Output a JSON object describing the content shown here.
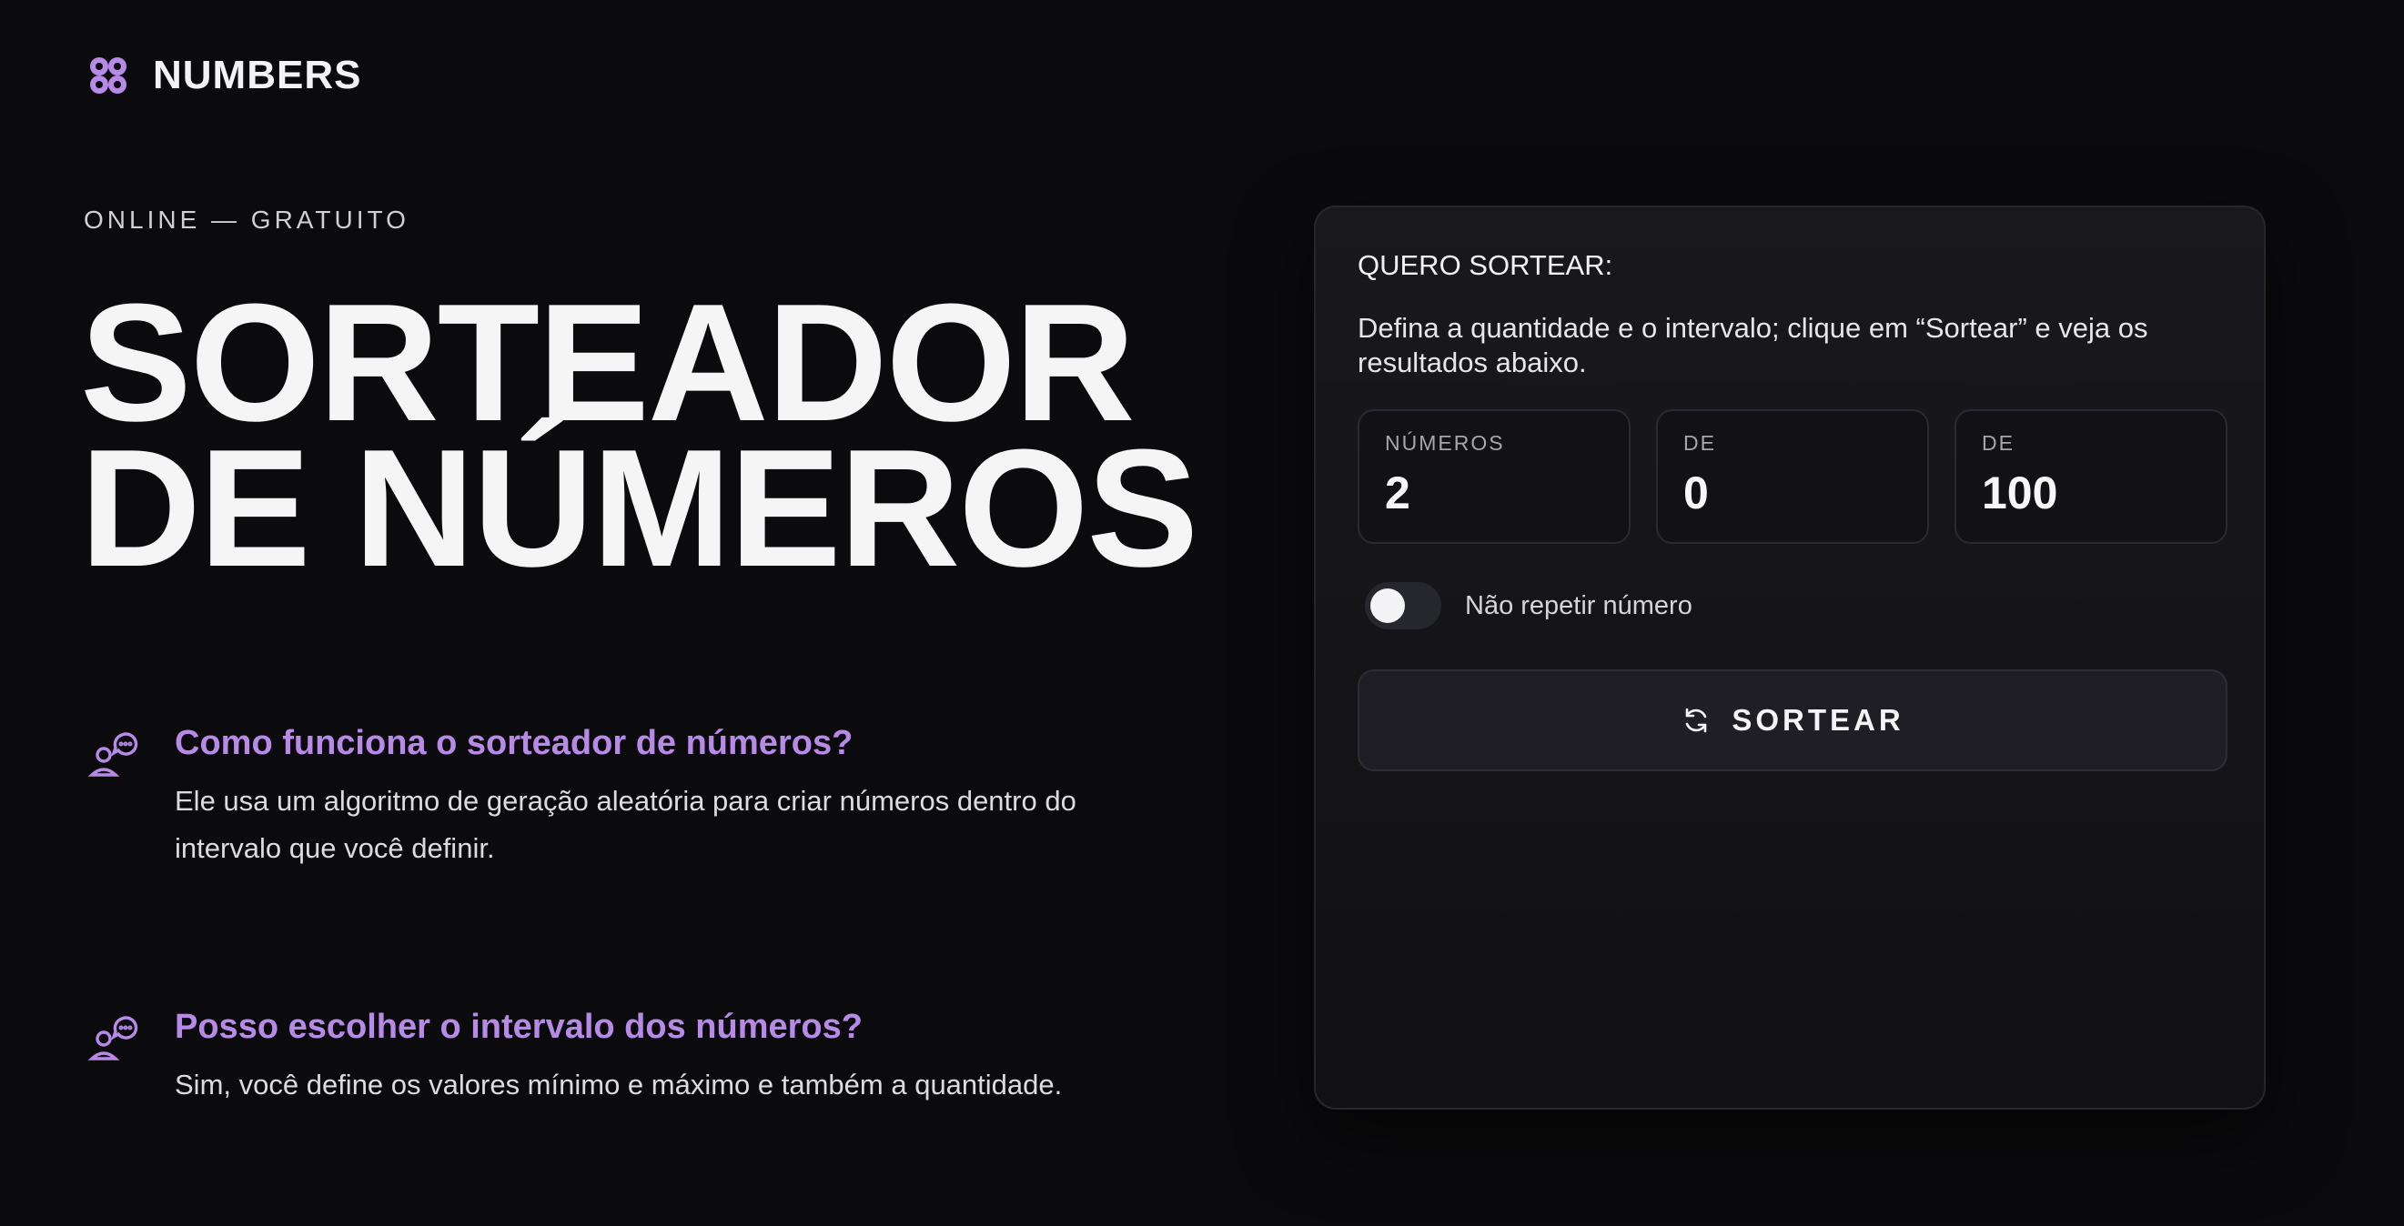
{
  "brand": {
    "name": "NUMBERS",
    "accent": "#b88ae8"
  },
  "hero": {
    "eyebrow": "ONLINE — GRATUITO",
    "title_line1": "SORTEADOR",
    "title_line2": "DE NÚMEROS"
  },
  "faq": [
    {
      "question": "Como funciona o sorteador de números?",
      "answer": "Ele usa um algoritmo de geração aleatória para criar números dentro do intervalo que você definir.",
      "icon": "person-chat-icon"
    },
    {
      "question": "Posso escolher o intervalo dos números?",
      "answer": "Sim, você define os valores mínimo e máximo e também a quantidade.",
      "icon": "person-chat-icon"
    }
  ],
  "card": {
    "title": "QUERO SORTEAR:",
    "description": "Defina a quantidade e o intervalo; clique em “Sortear” e veja os resultados abaixo.",
    "fields": [
      {
        "label": "NÚMEROS",
        "value": "2"
      },
      {
        "label": "DE",
        "value": "0"
      },
      {
        "label": "DE",
        "value": "100"
      }
    ],
    "toggle": {
      "label": "Não repetir número",
      "on": false
    },
    "button": {
      "label": "SORTEAR",
      "icon": "refresh-icon"
    }
  }
}
